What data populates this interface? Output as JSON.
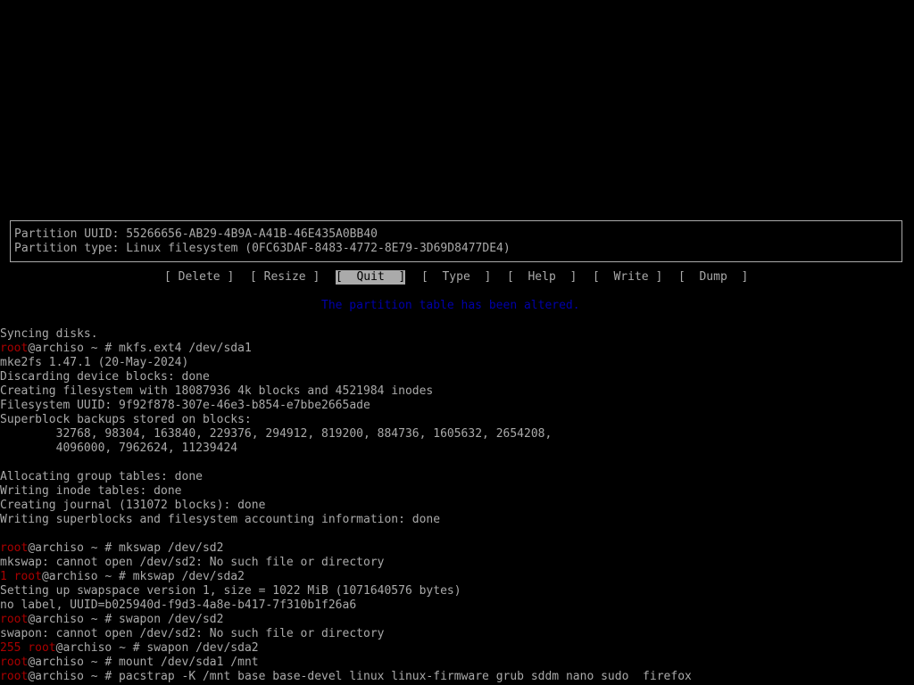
{
  "partition_info": {
    "uuid_line": "Partition UUID: 55266656-AB29-4B9A-A41B-46E435A0BB40",
    "type_line": "Partition type: Linux filesystem (0FC63DAF-8483-4772-8E79-3D69D8477DE4)"
  },
  "menu": {
    "delete": "[ Delete ]",
    "resize": "[ Resize ]",
    "quit": "[  Quit  ]",
    "type": "[  Type  ]",
    "help": "[  Help  ]",
    "write": "[  Write ]",
    "dump": "[  Dump  ]",
    "selected": "quit"
  },
  "status_message": "The partition table has been altered.",
  "terminal": {
    "l01": "Syncing disks.",
    "l02_user": "root",
    "l02_rest": "@archiso ~ # mkfs.ext4 /dev/sda1",
    "l03": "mke2fs 1.47.1 (20-May-2024)",
    "l04": "Discarding device blocks: done",
    "l05": "Creating filesystem with 18087936 4k blocks and 4521984 inodes",
    "l06": "Filesystem UUID: 9f92f878-307e-46e3-b854-e7bbe2665ade",
    "l07": "Superblock backups stored on blocks:",
    "l08": "        32768, 98304, 163840, 229376, 294912, 819200, 884736, 1605632, 2654208,",
    "l09": "        4096000, 7962624, 11239424",
    "l10": "Allocating group tables: done",
    "l11": "Writing inode tables: done",
    "l12": "Creating journal (131072 blocks): done",
    "l13": "Writing superblocks and filesystem accounting information: done",
    "l14_user": "root",
    "l14_rest": "@archiso ~ # mkswap /dev/sd2",
    "l15": "mkswap: cannot open /dev/sd2: No such file or directory",
    "l16_user": "1 root",
    "l16_rest": "@archiso ~ # mkswap /dev/sda2",
    "l17": "Setting up swapspace version 1, size = 1022 MiB (1071640576 bytes)",
    "l18": "no label, UUID=b025940d-f9d3-4a8e-b417-7f310b1f26a6",
    "l19_user": "root",
    "l19_rest": "@archiso ~ # swapon /dev/sd2",
    "l20": "swapon: cannot open /dev/sd2: No such file or directory",
    "l21_user": "255 root",
    "l21_rest": "@archiso ~ # swapon /dev/sda2",
    "l22_user": "root",
    "l22_rest": "@archiso ~ # mount /dev/sda1 /mnt",
    "l23_user": "root",
    "l23_rest": "@archiso ~ # pacstrap -K /mnt base base-devel linux linux-firmware grub sddm nano sudo  firefox"
  },
  "colors": {
    "background": "#000000",
    "text": "#aaaaaa",
    "prompt_user": "#aa0000",
    "status": "#0000aa",
    "selected_bg": "#aaaaaa"
  }
}
